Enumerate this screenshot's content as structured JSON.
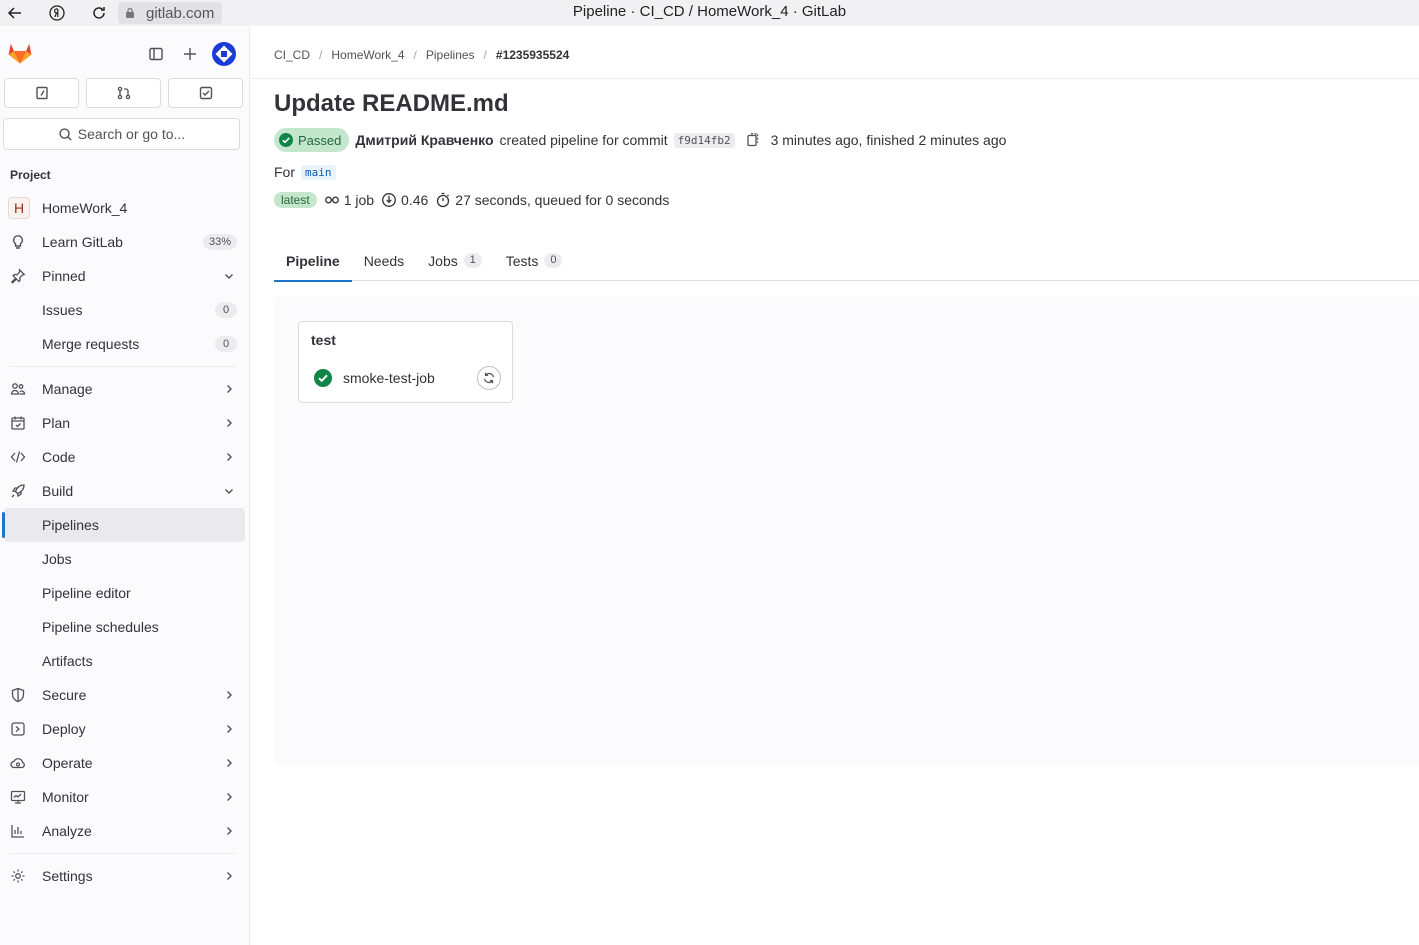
{
  "browser": {
    "url": "gitlab.com",
    "window_title": "Pipeline · CI_CD / HomeWork_4 · GitLab"
  },
  "sidebar": {
    "search_label": "Search or go to...",
    "section_label": "Project",
    "project_initial": "H",
    "items": [
      {
        "label": "HomeWork_4"
      },
      {
        "label": "Learn GitLab",
        "pill": "33%"
      },
      {
        "label": "Pinned"
      },
      {
        "label": "Issues",
        "pill": "0"
      },
      {
        "label": "Merge requests",
        "pill": "0"
      },
      {
        "label": "Manage"
      },
      {
        "label": "Plan"
      },
      {
        "label": "Code"
      },
      {
        "label": "Build"
      },
      {
        "label": "Pipelines"
      },
      {
        "label": "Jobs"
      },
      {
        "label": "Pipeline editor"
      },
      {
        "label": "Pipeline schedules"
      },
      {
        "label": "Artifacts"
      },
      {
        "label": "Secure"
      },
      {
        "label": "Deploy"
      },
      {
        "label": "Operate"
      },
      {
        "label": "Monitor"
      },
      {
        "label": "Analyze"
      },
      {
        "label": "Settings"
      }
    ]
  },
  "breadcrumb": {
    "items": [
      "CI_CD",
      "HomeWork_4",
      "Pipelines"
    ],
    "current": "#1235935524",
    "separator": "/"
  },
  "pipeline": {
    "title": "Update README.md",
    "status": "Passed",
    "author": "Дмитрий Кравченко",
    "created_text": "created pipeline for commit",
    "commit": "f9d14fb2",
    "time_text": "3 minutes ago, finished 2 minutes ago",
    "for_label": "For",
    "branch": "main",
    "latest_badge": "latest",
    "jobs_count": "1 job",
    "coverage": "0.46",
    "duration": "27 seconds, queued for 0 seconds"
  },
  "tabs": [
    {
      "label": "Pipeline"
    },
    {
      "label": "Needs"
    },
    {
      "label": "Jobs",
      "count": "1"
    },
    {
      "label": "Tests",
      "count": "0"
    }
  ],
  "graph": {
    "stage": "test",
    "job": "smoke-test-job"
  },
  "colors": {
    "accent": "#1f75cb",
    "success": "#108548",
    "success_bg": "#c3e6cd"
  }
}
